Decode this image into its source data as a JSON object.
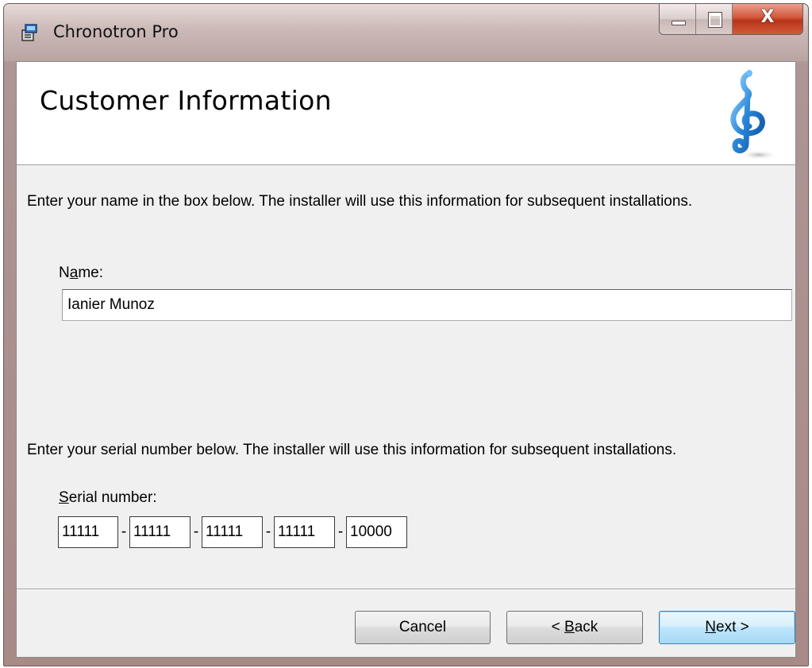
{
  "window": {
    "title": "Chronotron Pro",
    "accent_color": "#b9a4a2",
    "controls": {
      "minimize_icon": "minimize-icon",
      "maximize_icon": "maximize-icon",
      "close_icon": "close-icon",
      "close_glyph": "X"
    }
  },
  "banner": {
    "title": "Customer Information",
    "logo_icon": "treble-clef-icon"
  },
  "name_section": {
    "instructions": "Enter your name in the box below. The installer will use this information for subsequent installations.",
    "label_prefix": "N",
    "label_access_key": "a",
    "label_suffix": "me:",
    "value": "Ianier Munoz"
  },
  "serial_section": {
    "instructions": "Enter your serial number below. The installer will use this information for subsequent installations.",
    "label_access_key": "S",
    "label_suffix": "erial number:",
    "separator": "-",
    "parts": [
      "11111",
      "11111",
      "11111",
      "11111",
      "10000"
    ]
  },
  "buttons": {
    "cancel": "Cancel",
    "back_prefix": "< ",
    "back_access_key": "B",
    "back_suffix": "ack",
    "next_access_key": "N",
    "next_suffix": "ext >"
  }
}
